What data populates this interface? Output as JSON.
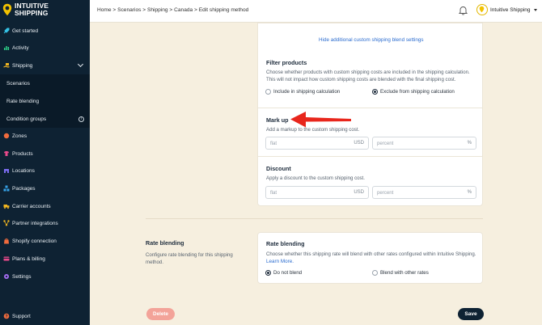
{
  "brand": {
    "line1": "INTUITIVE",
    "line2": "SHIPPING"
  },
  "sidebar": {
    "items": [
      {
        "label": "Get started",
        "icon": "rocket-icon",
        "color": "#35c3e6"
      },
      {
        "label": "Activity",
        "icon": "chart-icon",
        "color": "#2fd38a"
      },
      {
        "label": "Shipping",
        "icon": "hand-box-icon",
        "color": "#f2b620"
      },
      {
        "label": "Scenarios"
      },
      {
        "label": "Rate blending"
      },
      {
        "label": "Condition groups"
      },
      {
        "label": "Zones",
        "icon": "globe-icon",
        "color": "#f06b3d"
      },
      {
        "label": "Products",
        "icon": "shirt-icon",
        "color": "#ea4a8c"
      },
      {
        "label": "Locations",
        "icon": "building-icon",
        "color": "#7b6cf0"
      },
      {
        "label": "Packages",
        "icon": "boxes-icon",
        "color": "#36a3e8"
      },
      {
        "label": "Carrier accounts",
        "icon": "truck-icon",
        "color": "#f2b620"
      },
      {
        "label": "Partner integrations",
        "icon": "network-icon",
        "color": "#f2b620"
      },
      {
        "label": "Shopify connection",
        "icon": "bag-icon",
        "color": "#f06b3d"
      },
      {
        "label": "Plans & billing",
        "icon": "card-icon",
        "color": "#ea4a8c"
      },
      {
        "label": "Settings",
        "icon": "gear-icon",
        "color": "#a46cf0"
      },
      {
        "label": "Support",
        "icon": "help-icon",
        "color": "#f06b3d"
      }
    ]
  },
  "header": {
    "breadcrumb": "Home > Scenarios > Shipping > Canada > Edit shipping method",
    "store_name": "Intuitive Shipping"
  },
  "blend_settings": {
    "hide_link": "Hide additional custom shipping blend settings",
    "filter_title": "Filter products",
    "filter_desc": "Choose whether products with custom shipping costs are included in the shipping calculation. This will not impact how custom shipping costs are blended with the final shipping cost.",
    "include_label": "Include in shipping calculation",
    "exclude_label": "Exclude from shipping calculation",
    "markup_title": "Mark up",
    "markup_desc": "Add a markup to the custom shipping cost.",
    "discount_title": "Discount",
    "discount_desc": "Apply a discount to the custom shipping cost.",
    "flat_placeholder": "flat",
    "percent_placeholder": "percent",
    "currency_unit": "USD",
    "percent_unit": "%"
  },
  "rate_blending": {
    "section_title": "Rate blending",
    "section_desc": "Configure rate blending for this shipping method.",
    "card_title": "Rate blending",
    "card_desc": "Choose whether this shipping rate will blend with other rates configured within Intuitive Shipping.",
    "learn_more": "Learn More.",
    "do_not_blend": "Do not blend",
    "blend_with_others": "Blend with other rates"
  },
  "footer": {
    "delete_label": "Delete",
    "save_label": "Save"
  },
  "colors": {
    "sidebar_bg": "#0e2233",
    "page_bg": "#f6efdf",
    "accent": "#2b6ccf",
    "arrow": "#e8261c",
    "delete_bg": "#f3a399"
  }
}
